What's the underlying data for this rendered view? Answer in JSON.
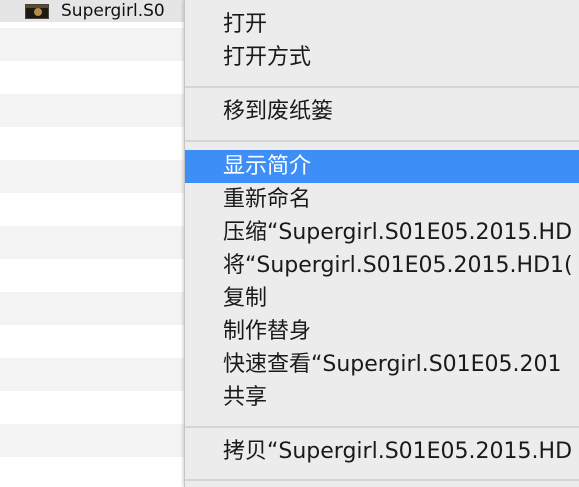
{
  "finder": {
    "selected_file": {
      "name": "Supergirl.S0",
      "thumbnail_icon": "video-thumbnail-icon"
    }
  },
  "context_menu": {
    "highlight_color": "#3e8ef7",
    "items": [
      {
        "label": "打开"
      },
      {
        "label": "打开方式"
      },
      {
        "label": "移到废纸篓"
      },
      {
        "label": "显示简介",
        "highlighted": true
      },
      {
        "label": "重新命名"
      },
      {
        "label": "压缩“Supergirl.S01E05.2015.HD"
      },
      {
        "label": "将“Supergirl.S01E05.2015.HD1("
      },
      {
        "label": "复制"
      },
      {
        "label": "制作替身"
      },
      {
        "label": "快速查看“Supergirl.S01E05.201"
      },
      {
        "label": "共享"
      },
      {
        "label": "拷贝“Supergirl.S01E05.2015.HD"
      }
    ]
  }
}
